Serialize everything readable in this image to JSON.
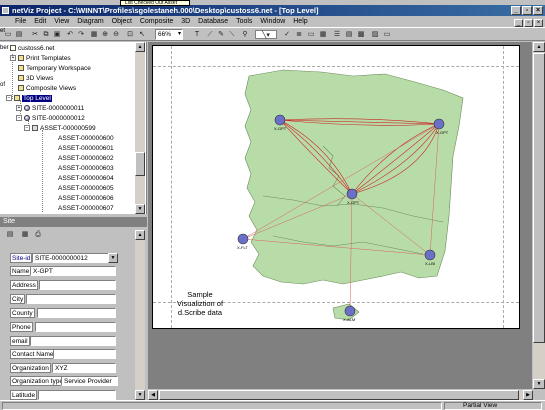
{
  "window": {
    "tooltip": "List Checked Out Asset",
    "title": "netViz Project - C:\\WINNT\\Profiles\\sgolestaneh.000\\Desktop\\custoss6.net - [Top Level]",
    "controls": [
      "_",
      "▫",
      "×"
    ]
  },
  "menu": [
    "File",
    "Edit",
    "View",
    "Diagram",
    "Object",
    "Composite",
    "3D",
    "Database",
    "Tools",
    "Window",
    "Help"
  ],
  "mdi_controls": [
    "_",
    "▫",
    "×"
  ],
  "toolbar": {
    "zoom": "66%",
    "left_labels": [
      "et",
      "ber",
      "of"
    ]
  },
  "tree": {
    "items": [
      {
        "label": "custoss6.net",
        "icon": "file",
        "level": 0
      },
      {
        "label": "Print Templates",
        "icon": "folder",
        "level": 1,
        "expander": "+"
      },
      {
        "label": "Temporary Workspace",
        "icon": "folder",
        "level": 1
      },
      {
        "label": "3D Views",
        "icon": "folder",
        "level": 1
      },
      {
        "label": "Composite Views",
        "icon": "folder",
        "level": 1
      },
      {
        "label": "Top Level",
        "icon": "folder",
        "level": 1,
        "expander": "-",
        "selected": true
      },
      {
        "label": "SITE-0000000011",
        "icon": "site",
        "level": 2,
        "expander": "+"
      },
      {
        "label": "SITE-0000000012",
        "icon": "site",
        "level": 2,
        "expander": "-"
      },
      {
        "label": "ASSET-000000599",
        "icon": "asset",
        "level": 3,
        "expander": "-"
      },
      {
        "label": "ASSET-000000600",
        "icon": "none",
        "level": 4
      },
      {
        "label": "ASSET-000000601",
        "icon": "none",
        "level": 4
      },
      {
        "label": "ASSET-000000602",
        "icon": "none",
        "level": 4
      },
      {
        "label": "ASSET-000000603",
        "icon": "none",
        "level": 4
      },
      {
        "label": "ASSET-000000604",
        "icon": "none",
        "level": 4
      },
      {
        "label": "ASSET-000000605",
        "icon": "none",
        "level": 4
      },
      {
        "label": "ASSET-000000606",
        "icon": "none",
        "level": 4
      },
      {
        "label": "ASSET-000000607",
        "icon": "none",
        "level": 4
      }
    ]
  },
  "site_panel": {
    "title": "Site",
    "fields": [
      {
        "label": "Site-id",
        "value": "SITE-0000000012",
        "dropdown": true
      },
      {
        "label": "Name",
        "value": "X-GPT"
      },
      {
        "label": "Address",
        "value": ""
      },
      {
        "label": "City",
        "value": ""
      },
      {
        "label": "County",
        "value": ""
      },
      {
        "label": "Phone",
        "value": ""
      },
      {
        "label": "email",
        "value": ""
      },
      {
        "label": "Contact Name",
        "value": ""
      },
      {
        "label": "Organization",
        "value": "XYZ"
      },
      {
        "label": "Organization type",
        "value": "Service Provider"
      },
      {
        "label": "Latitude",
        "value": ""
      }
    ]
  },
  "map": {
    "caption": [
      "Sample",
      "Visualiztion of",
      "d.Scribe data"
    ],
    "node_labels": [
      "X-GPT",
      "X-GPT",
      "X-GPT",
      "X-FLT",
      "X-LBI",
      "X-ALM"
    ]
  },
  "status": {
    "view": "Partial View"
  }
}
